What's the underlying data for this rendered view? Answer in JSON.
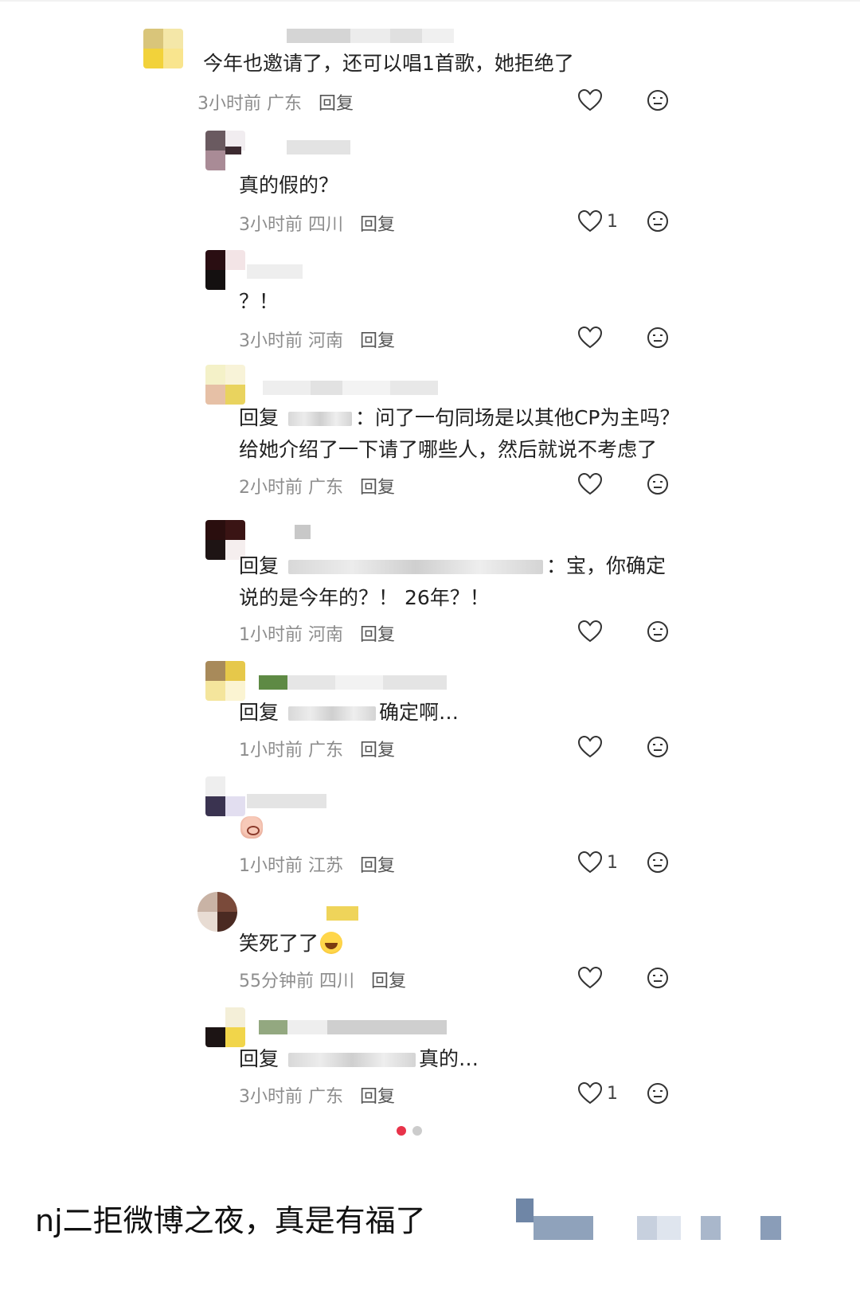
{
  "comments": [
    {
      "text": "今年也邀请了，还可以唱1首歌，她拒绝了",
      "time": "3小时前",
      "location": "广东",
      "reply_label": "回复",
      "like_count": ""
    },
    {
      "text": "真的假的？",
      "time": "3小时前",
      "location": "四川",
      "reply_label": "回复",
      "like_count": "1"
    },
    {
      "text": "？！",
      "time": "3小时前",
      "location": "河南",
      "reply_label": "回复",
      "like_count": ""
    },
    {
      "reply_prefix": "回复",
      "text_line1": "：问了一句同场是以其他CP为主吗？",
      "text_line2": "给她介绍了一下请了哪些人，然后就说不考虑了",
      "time": "2小时前",
      "location": "广东",
      "reply_label": "回复",
      "like_count": ""
    },
    {
      "reply_prefix": "回复",
      "text_line1": "：宝，你确定",
      "text_line2": "说的是今年的？！ 26年？！",
      "time": "1小时前",
      "location": "河南",
      "reply_label": "回复",
      "like_count": ""
    },
    {
      "reply_prefix": "回复",
      "text": "确定啊…",
      "time": "1小时前",
      "location": "广东",
      "reply_label": "回复",
      "like_count": ""
    },
    {
      "emoji": "crying-face",
      "time": "1小时前",
      "location": "江苏",
      "reply_label": "回复",
      "like_count": "1"
    },
    {
      "text": "笑死了了",
      "emoji": "laughing-face",
      "time": "55分钟前",
      "location": "四川",
      "reply_label": "回复",
      "like_count": ""
    },
    {
      "reply_prefix": "回复",
      "text": "真的…",
      "time": "3小时前",
      "location": "广东",
      "reply_label": "回复",
      "like_count": "1"
    }
  ],
  "carousel": {
    "count": 2,
    "active_index": 0,
    "active_color": "#e8334a"
  },
  "caption": "nj二拒微博之夜，真是有福了",
  "icons": {
    "like": "heart-outline-icon",
    "emoji": "emoji-face-icon"
  }
}
